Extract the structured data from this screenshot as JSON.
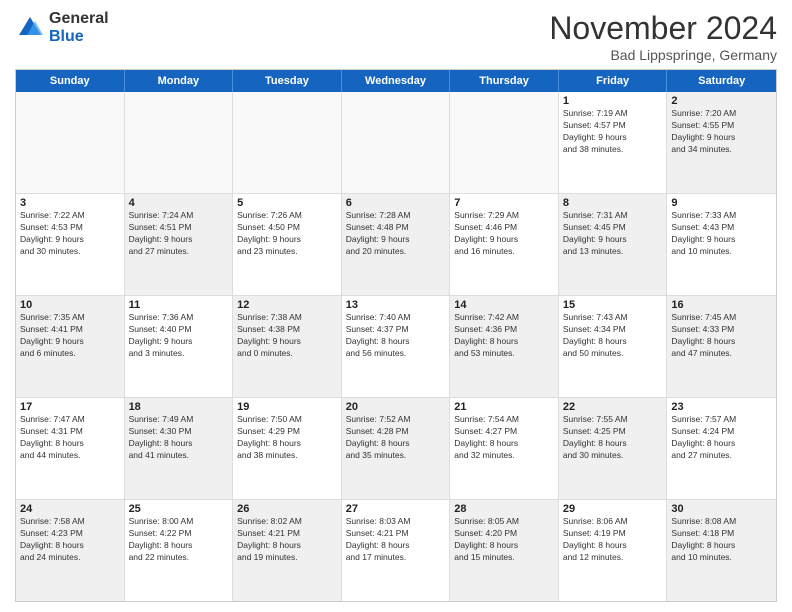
{
  "logo": {
    "general": "General",
    "blue": "Blue"
  },
  "header": {
    "month": "November 2024",
    "location": "Bad Lippspringe, Germany"
  },
  "weekdays": [
    "Sunday",
    "Monday",
    "Tuesday",
    "Wednesday",
    "Thursday",
    "Friday",
    "Saturday"
  ],
  "weeks": [
    [
      {
        "day": "",
        "info": "",
        "empty": true
      },
      {
        "day": "",
        "info": "",
        "empty": true
      },
      {
        "day": "",
        "info": "",
        "empty": true
      },
      {
        "day": "",
        "info": "",
        "empty": true
      },
      {
        "day": "",
        "info": "",
        "empty": true
      },
      {
        "day": "1",
        "info": "Sunrise: 7:19 AM\nSunset: 4:57 PM\nDaylight: 9 hours\nand 38 minutes.",
        "empty": false
      },
      {
        "day": "2",
        "info": "Sunrise: 7:20 AM\nSunset: 4:55 PM\nDaylight: 9 hours\nand 34 minutes.",
        "empty": false,
        "shaded": true
      }
    ],
    [
      {
        "day": "3",
        "info": "Sunrise: 7:22 AM\nSunset: 4:53 PM\nDaylight: 9 hours\nand 30 minutes.",
        "empty": false
      },
      {
        "day": "4",
        "info": "Sunrise: 7:24 AM\nSunset: 4:51 PM\nDaylight: 9 hours\nand 27 minutes.",
        "empty": false,
        "shaded": true
      },
      {
        "day": "5",
        "info": "Sunrise: 7:26 AM\nSunset: 4:50 PM\nDaylight: 9 hours\nand 23 minutes.",
        "empty": false
      },
      {
        "day": "6",
        "info": "Sunrise: 7:28 AM\nSunset: 4:48 PM\nDaylight: 9 hours\nand 20 minutes.",
        "empty": false,
        "shaded": true
      },
      {
        "day": "7",
        "info": "Sunrise: 7:29 AM\nSunset: 4:46 PM\nDaylight: 9 hours\nand 16 minutes.",
        "empty": false
      },
      {
        "day": "8",
        "info": "Sunrise: 7:31 AM\nSunset: 4:45 PM\nDaylight: 9 hours\nand 13 minutes.",
        "empty": false,
        "shaded": true
      },
      {
        "day": "9",
        "info": "Sunrise: 7:33 AM\nSunset: 4:43 PM\nDaylight: 9 hours\nand 10 minutes.",
        "empty": false
      }
    ],
    [
      {
        "day": "10",
        "info": "Sunrise: 7:35 AM\nSunset: 4:41 PM\nDaylight: 9 hours\nand 6 minutes.",
        "empty": false,
        "shaded": true
      },
      {
        "day": "11",
        "info": "Sunrise: 7:36 AM\nSunset: 4:40 PM\nDaylight: 9 hours\nand 3 minutes.",
        "empty": false
      },
      {
        "day": "12",
        "info": "Sunrise: 7:38 AM\nSunset: 4:38 PM\nDaylight: 9 hours\nand 0 minutes.",
        "empty": false,
        "shaded": true
      },
      {
        "day": "13",
        "info": "Sunrise: 7:40 AM\nSunset: 4:37 PM\nDaylight: 8 hours\nand 56 minutes.",
        "empty": false
      },
      {
        "day": "14",
        "info": "Sunrise: 7:42 AM\nSunset: 4:36 PM\nDaylight: 8 hours\nand 53 minutes.",
        "empty": false,
        "shaded": true
      },
      {
        "day": "15",
        "info": "Sunrise: 7:43 AM\nSunset: 4:34 PM\nDaylight: 8 hours\nand 50 minutes.",
        "empty": false
      },
      {
        "day": "16",
        "info": "Sunrise: 7:45 AM\nSunset: 4:33 PM\nDaylight: 8 hours\nand 47 minutes.",
        "empty": false,
        "shaded": true
      }
    ],
    [
      {
        "day": "17",
        "info": "Sunrise: 7:47 AM\nSunset: 4:31 PM\nDaylight: 8 hours\nand 44 minutes.",
        "empty": false
      },
      {
        "day": "18",
        "info": "Sunrise: 7:49 AM\nSunset: 4:30 PM\nDaylight: 8 hours\nand 41 minutes.",
        "empty": false,
        "shaded": true
      },
      {
        "day": "19",
        "info": "Sunrise: 7:50 AM\nSunset: 4:29 PM\nDaylight: 8 hours\nand 38 minutes.",
        "empty": false
      },
      {
        "day": "20",
        "info": "Sunrise: 7:52 AM\nSunset: 4:28 PM\nDaylight: 8 hours\nand 35 minutes.",
        "empty": false,
        "shaded": true
      },
      {
        "day": "21",
        "info": "Sunrise: 7:54 AM\nSunset: 4:27 PM\nDaylight: 8 hours\nand 32 minutes.",
        "empty": false
      },
      {
        "day": "22",
        "info": "Sunrise: 7:55 AM\nSunset: 4:25 PM\nDaylight: 8 hours\nand 30 minutes.",
        "empty": false,
        "shaded": true
      },
      {
        "day": "23",
        "info": "Sunrise: 7:57 AM\nSunset: 4:24 PM\nDaylight: 8 hours\nand 27 minutes.",
        "empty": false
      }
    ],
    [
      {
        "day": "24",
        "info": "Sunrise: 7:58 AM\nSunset: 4:23 PM\nDaylight: 8 hours\nand 24 minutes.",
        "empty": false,
        "shaded": true
      },
      {
        "day": "25",
        "info": "Sunrise: 8:00 AM\nSunset: 4:22 PM\nDaylight: 8 hours\nand 22 minutes.",
        "empty": false
      },
      {
        "day": "26",
        "info": "Sunrise: 8:02 AM\nSunset: 4:21 PM\nDaylight: 8 hours\nand 19 minutes.",
        "empty": false,
        "shaded": true
      },
      {
        "day": "27",
        "info": "Sunrise: 8:03 AM\nSunset: 4:21 PM\nDaylight: 8 hours\nand 17 minutes.",
        "empty": false
      },
      {
        "day": "28",
        "info": "Sunrise: 8:05 AM\nSunset: 4:20 PM\nDaylight: 8 hours\nand 15 minutes.",
        "empty": false,
        "shaded": true
      },
      {
        "day": "29",
        "info": "Sunrise: 8:06 AM\nSunset: 4:19 PM\nDaylight: 8 hours\nand 12 minutes.",
        "empty": false
      },
      {
        "day": "30",
        "info": "Sunrise: 8:08 AM\nSunset: 4:18 PM\nDaylight: 8 hours\nand 10 minutes.",
        "empty": false,
        "shaded": true
      }
    ]
  ]
}
